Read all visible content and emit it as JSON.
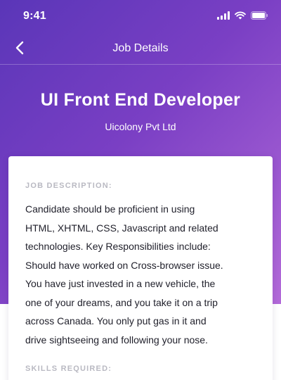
{
  "status_bar": {
    "time": "9:41",
    "icons": [
      "cellular-signal-icon",
      "wifi-icon",
      "battery-icon"
    ]
  },
  "nav": {
    "back_icon": "chevron-left-icon",
    "title": "Job Details"
  },
  "job": {
    "title": "UI Front End Developer",
    "company": "Uicolony Pvt Ltd"
  },
  "card": {
    "description_label": "JOB DESCRIPTION:",
    "description_lines": [
      "Candidate should be proficient in using",
      "HTML, XHTML, CSS, Javascript and related",
      "technologies. Key Responsibilities include:",
      "Should have worked on Cross-browser issue.",
      "You have just invested in a new vehicle, the",
      "one of your dreams, and you take it on a trip",
      "across Canada. You only put gas in it and",
      "drive sightseeing and following your nose."
    ],
    "skills_label": "SKILLS REQUIRED:"
  },
  "colors": {
    "gradient_start": "#5a36b8",
    "gradient_end": "#b36ad9",
    "label_gray": "#b9b9c2",
    "text_dark": "#1f1f2a"
  }
}
